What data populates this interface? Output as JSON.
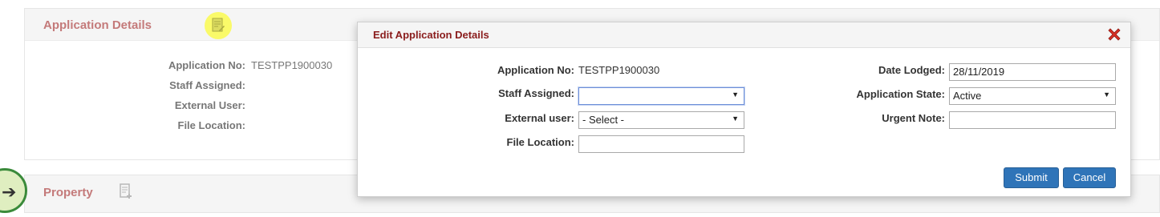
{
  "background": {
    "application_panel": {
      "title": "Application Details",
      "rows": [
        {
          "label": "Application No:",
          "value": "TESTPP1900030"
        },
        {
          "label": "Staff Assigned:",
          "value": ""
        },
        {
          "label": "External User:",
          "value": ""
        },
        {
          "label": "File Location:",
          "value": ""
        }
      ]
    },
    "property_panel": {
      "title": "Property"
    }
  },
  "modal": {
    "title": "Edit Application Details",
    "left": {
      "application_no_label": "Application No:",
      "application_no_value": "TESTPP1900030",
      "staff_assigned_label": "Staff Assigned:",
      "staff_assigned_value": "",
      "external_user_label": "External user:",
      "external_user_value": "- Select -",
      "file_location_label": "File Location:",
      "file_location_value": ""
    },
    "right": {
      "date_lodged_label": "Date Lodged:",
      "date_lodged_value": "28/11/2019",
      "application_state_label": "Application State:",
      "application_state_value": "Active",
      "urgent_note_label": "Urgent Note:",
      "urgent_note_value": ""
    },
    "buttons": {
      "submit": "Submit",
      "cancel": "Cancel"
    }
  },
  "icons": [
    "document-edit-icon",
    "add-document-icon",
    "close-icon",
    "arrow-right-icon"
  ],
  "colors": {
    "title": "#c47a7a",
    "modal_title": "#8a1c1c",
    "button": "#2f74b8",
    "close": "#d93025",
    "highlight": "#fafa50"
  }
}
